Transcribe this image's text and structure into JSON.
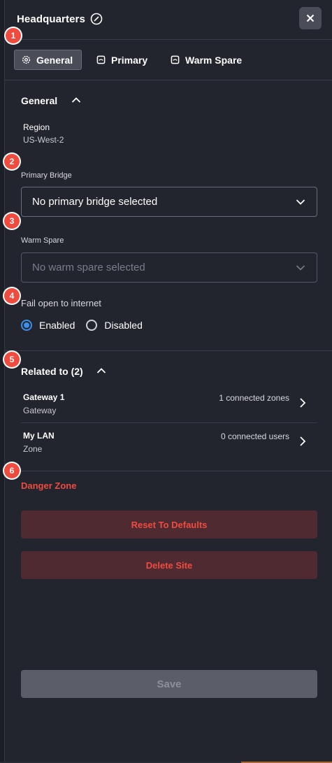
{
  "header": {
    "title": "Headquarters",
    "edit_icon": "edit-circle-icon",
    "close_icon": "close-icon"
  },
  "tabs": [
    {
      "label": "General",
      "icon": "gear-icon",
      "active": true
    },
    {
      "label": "Primary",
      "icon": "bridge-icon",
      "active": false
    },
    {
      "label": "Warm Spare",
      "icon": "bridge-icon",
      "active": false
    }
  ],
  "general": {
    "title": "General",
    "region_label": "Region",
    "region_value": "US-West-2",
    "primary_bridge_label": "Primary Bridge",
    "primary_bridge_value": "No primary bridge selected",
    "warm_spare_label": "Warm Spare",
    "warm_spare_placeholder": "No warm spare selected",
    "fail_open_label": "Fail open to internet",
    "fail_open_options": [
      {
        "label": "Enabled",
        "selected": true
      },
      {
        "label": "Disabled",
        "selected": false
      }
    ]
  },
  "related": {
    "title": "Related to (2)",
    "items": [
      {
        "name": "Gateway 1",
        "type": "Gateway",
        "meta": "1 connected zones"
      },
      {
        "name": "My LAN",
        "type": "Zone",
        "meta": "0 connected users"
      }
    ]
  },
  "danger": {
    "title": "Danger Zone",
    "reset_label": "Reset To Defaults",
    "delete_label": "Delete Site"
  },
  "footer": {
    "save_label": "Save"
  },
  "badges": [
    "1",
    "2",
    "3",
    "4",
    "5",
    "6"
  ],
  "colors": {
    "accent": "#3b8fe6",
    "danger": "#ef4b3f",
    "badge": "#ef4b3f",
    "background": "#23252e"
  }
}
